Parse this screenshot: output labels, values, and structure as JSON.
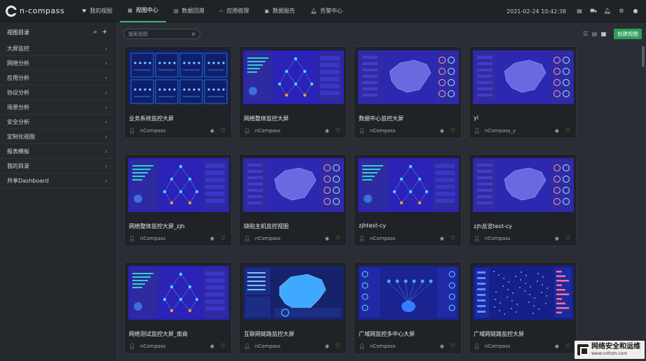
{
  "app": {
    "logo_text": "n-compass",
    "datetime": "2021-02-24 10:42:38"
  },
  "nav": [
    {
      "label": "我的视图",
      "icon": "heart-icon",
      "active": false
    },
    {
      "label": "视图中心",
      "icon": "grid-icon",
      "active": true
    },
    {
      "label": "数据回溯",
      "icon": "table-icon",
      "active": false
    },
    {
      "label": "应用梳理",
      "icon": "sitemap-icon",
      "active": false
    },
    {
      "label": "数据报告",
      "icon": "report-icon",
      "active": false
    },
    {
      "label": "告警中心",
      "icon": "bell-icon",
      "active": false
    }
  ],
  "topbar_icons": [
    "menu-icon",
    "car-icon",
    "notification-bell-icon",
    "gear-icon",
    "user-icon"
  ],
  "sidebar": {
    "title": "视图目录",
    "items": [
      {
        "label": "大屏监控"
      },
      {
        "label": "网络分析"
      },
      {
        "label": "应用分析"
      },
      {
        "label": "协议分析"
      },
      {
        "label": "场景分析"
      },
      {
        "label": "安全分析"
      },
      {
        "label": "定制化视图"
      },
      {
        "label": "报表模板"
      },
      {
        "label": "我的目录"
      },
      {
        "label": "共享Dashboard"
      }
    ]
  },
  "search": {
    "placeholder": "搜索视图"
  },
  "toolbar": {
    "create_label": "创建视图"
  },
  "cards": [
    {
      "title": "业务系统监控大屏",
      "owner": "nCompass",
      "thumb": "topology"
    },
    {
      "title": "网络整体监控大屏",
      "owner": "nCompass",
      "thumb": "network"
    },
    {
      "title": "数据中心监控大屏",
      "owner": "nCompass",
      "thumb": "map"
    },
    {
      "title": "yl",
      "owner": "nCompass_y",
      "thumb": "map"
    },
    {
      "title": "网络整体监控大屏_zjh",
      "owner": "nCompass",
      "thumb": "network"
    },
    {
      "title": "缺陷主机监控视图",
      "owner": "nCompass",
      "thumb": "map"
    },
    {
      "title": "zjhtest-cy",
      "owner": "nCompass",
      "thumb": "network"
    },
    {
      "title": "zjh总览test-cy",
      "owner": "nCompass",
      "thumb": "map"
    },
    {
      "title": "网络测试监控大屏_南商",
      "owner": "nCompass",
      "thumb": "network"
    },
    {
      "title": "互联网链路监控大屏",
      "owner": "nCompass",
      "thumb": "bluemap"
    },
    {
      "title": "广域网监控多中心大屏",
      "owner": "nCompass",
      "thumb": "multicenter"
    },
    {
      "title": "广域网链路监控大屏",
      "owner": "nCompass",
      "thumb": "links"
    }
  ],
  "watermark": {
    "cn": "网络安全和运维",
    "url": "www.cnitom.com"
  }
}
